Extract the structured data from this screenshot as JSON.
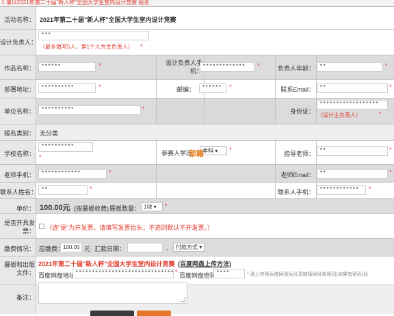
{
  "top_note": "1.请以2021年第二十届\"新人杯\"全国大学生室内设计竞赛 报名",
  "activity": {
    "label": "活动名称：",
    "value": "2021年第二十届\"新人杯\"全国大学生室内设计竞赛"
  },
  "designer": {
    "label": "设计负责人：",
    "value": "***",
    "hint": "（最多填写5人，第1个人为主负责人）",
    "star": "*"
  },
  "row_work": {
    "work_name_label": "作品名称：",
    "work_name_value": "******",
    "designer_phone_label": "设计负责人手机：",
    "designer_phone_value": "*************",
    "age_label": "负责人年龄：",
    "age_value": "**"
  },
  "row_dept": {
    "dept_label": "部署地址：",
    "dept_value": "**********",
    "post_label": "邮编：",
    "post_value": "******",
    "email_label": "联系Email：",
    "email_value": "**"
  },
  "row_unit": {
    "unit_label": "单位名称：",
    "unit_value": "**********",
    "id_label": "身份证：",
    "id_value": "******************",
    "id_hint": "（设计主负责人）"
  },
  "category": {
    "label": "报名类别：",
    "value": "无分类"
  },
  "row_school": {
    "school_label": "学校名称：",
    "school_value": "**********",
    "participant_label": "参赛人学历：",
    "participant_select": "本科",
    "watermark": "部籍",
    "teacher_label": "指导老师：",
    "teacher_value": "**"
  },
  "row_teacher_phone": {
    "label": "老师手机：",
    "value": "************",
    "email_label": "老师Email：",
    "email_value": "**"
  },
  "row_contact": {
    "name_label": "联系人姓名：",
    "name_value": "**",
    "phone_label": "联系人手机：",
    "phone_value": "************"
  },
  "price": {
    "label": "单价：",
    "value": "100.00元",
    "note": "(按展板收费)",
    "count_label": "展板数量：",
    "count_select": "1块"
  },
  "invoice": {
    "label": "是否开具发票：",
    "hint": "（选\"是\"为开发票，请填写发票抬头；不选则默认不开发票。）"
  },
  "payment": {
    "label": "缴费情况：",
    "amount_label": "应缴费：",
    "amount_value": "100.00",
    "unit": "元",
    "date_label": "汇款日期：",
    "method_select": "付款方式"
  },
  "upload": {
    "label": "展板和出版文件：",
    "title": "2021年第二十届\"新人杯\"全国大学生室内设计竞赛",
    "title_link": "(百度网盘上传方法)",
    "baidu_label": "百度网盘地址：",
    "baidu_value": "******************************",
    "pwd_label": "百度网盘密码：",
    "pwd_value": "****",
    "note": "* 请上传到百度网盘后分享链接网址和密码(如果有密码)此"
  },
  "remark": {
    "label": "备注："
  }
}
